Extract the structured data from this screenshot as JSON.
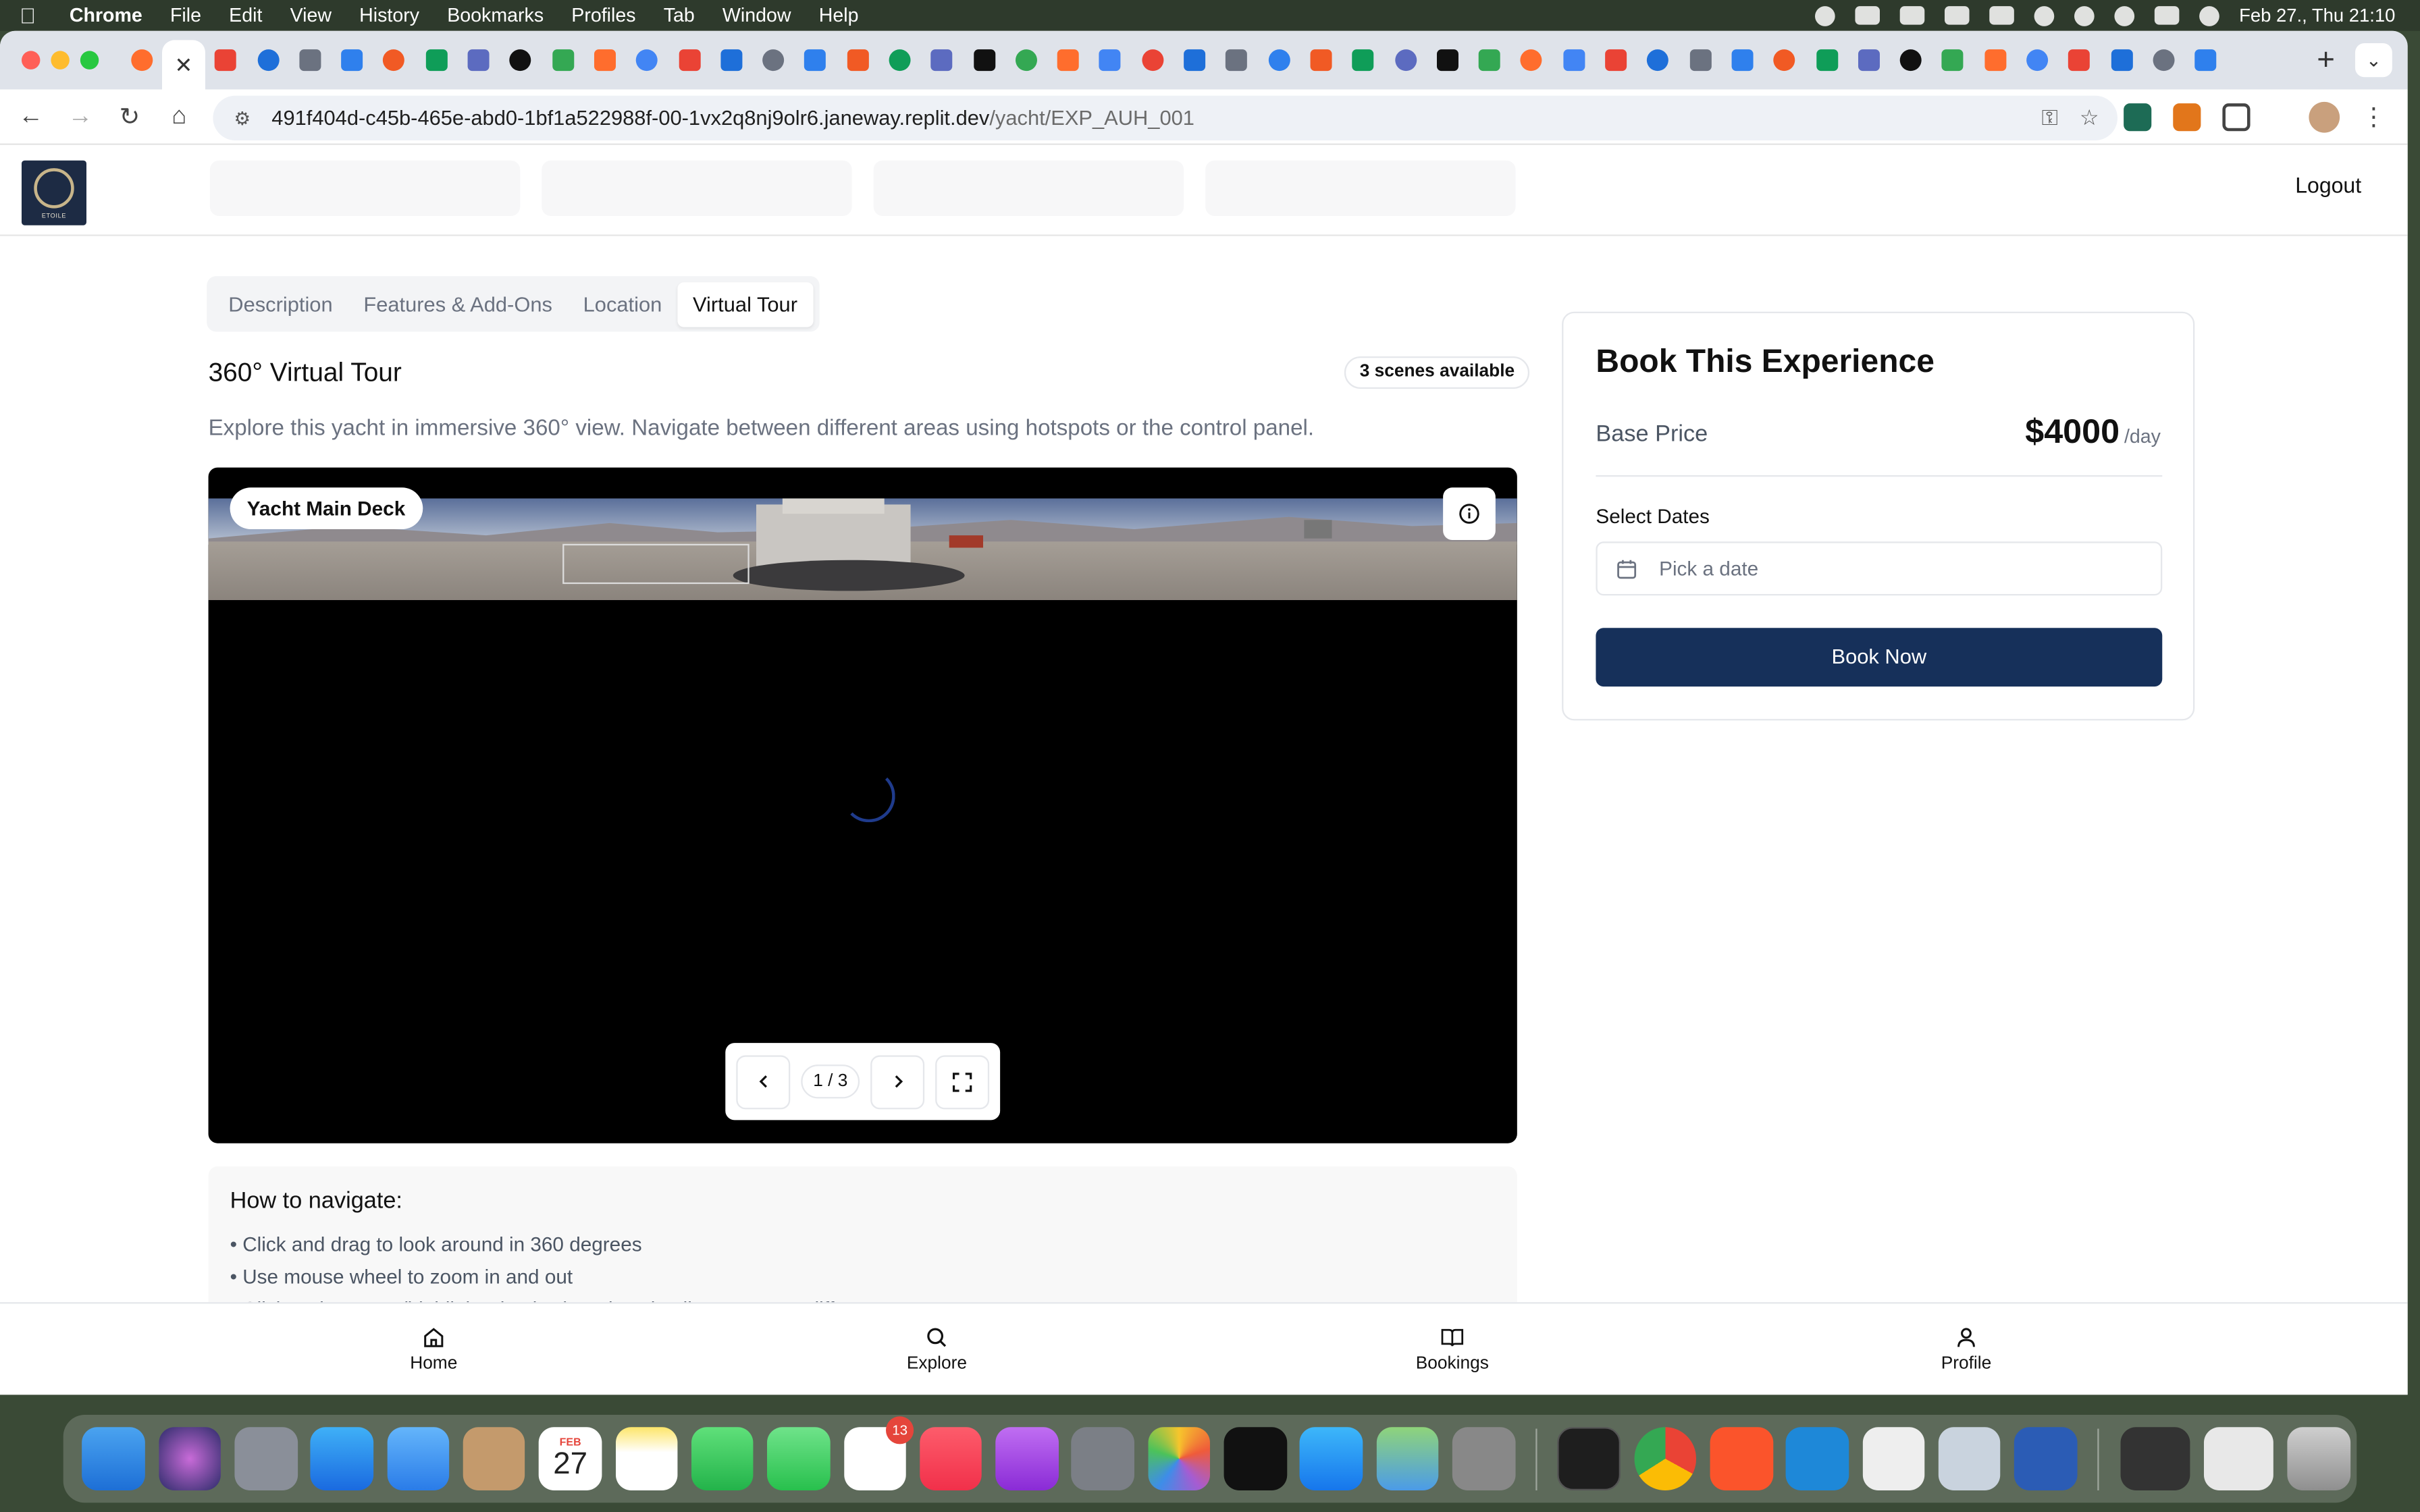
{
  "menubar": {
    "app": "Chrome",
    "items": [
      "File",
      "Edit",
      "View",
      "History",
      "Bookmarks",
      "Profiles",
      "Tab",
      "Window",
      "Help"
    ],
    "datetime": "Feb 27., Thu 21:10"
  },
  "browser": {
    "url_host": "491f404d-c45b-465e-abd0-1bf1a522988f-00-1vx2q8nj9olr6.janeway.replit.dev",
    "url_path": "/yacht/EXP_AUH_001",
    "tab_count": 50,
    "active_tab_index": 1
  },
  "header": {
    "logo_text": "ETOILE",
    "logout_label": "Logout"
  },
  "tabs": [
    {
      "label": "Description",
      "active": false
    },
    {
      "label": "Features & Add-Ons",
      "active": false
    },
    {
      "label": "Location",
      "active": false
    },
    {
      "label": "Virtual Tour",
      "active": true
    }
  ],
  "virtual_tour": {
    "title": "360° Virtual Tour",
    "badge": "3 scenes available",
    "description": "Explore this yacht in immersive 360° view. Navigate between different areas using hotspots or the control panel.",
    "scene_label": "Yacht Main Deck",
    "counter": "1 / 3"
  },
  "howto": {
    "title": "How to navigate:",
    "items": [
      "• Click and drag to look around in 360 degrees",
      "• Use mouse wheel to zoom in and out",
      "• Click on hotspots (highlighted points) to view details or move to different areas"
    ]
  },
  "booking": {
    "title": "Book This Experience",
    "base_price_label": "Base Price",
    "price": "$4000",
    "price_unit": "/day",
    "select_dates_label": "Select Dates",
    "date_placeholder": "Pick a date",
    "book_button": "Book Now"
  },
  "bottom_nav": [
    {
      "label": "Home",
      "icon": "home-icon"
    },
    {
      "label": "Explore",
      "icon": "search-icon"
    },
    {
      "label": "Bookings",
      "icon": "book-icon"
    },
    {
      "label": "Profile",
      "icon": "user-icon"
    }
  ],
  "dock": {
    "calendar_month": "FEB",
    "calendar_day": "27",
    "reminders_badge": "13"
  },
  "colors": {
    "primary": "#16305a",
    "viewer_bg": "#000000"
  }
}
